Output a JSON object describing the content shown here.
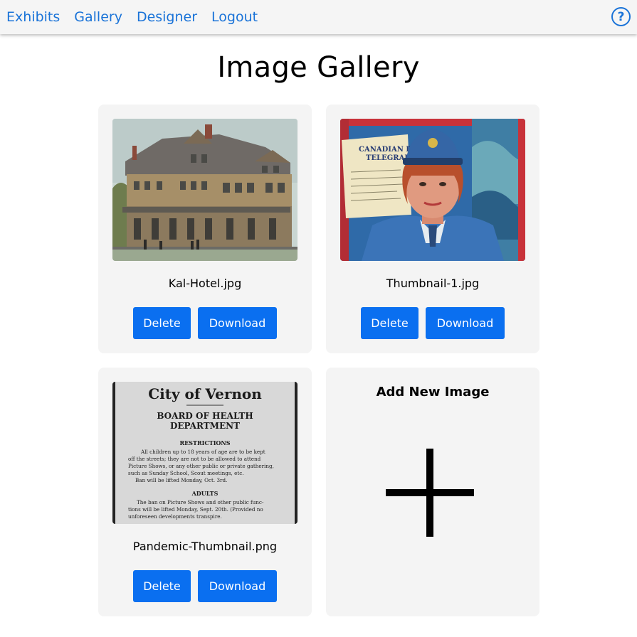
{
  "nav": {
    "links": [
      "Exhibits",
      "Gallery",
      "Designer",
      "Logout"
    ],
    "help_icon": "question-circle-icon",
    "help_glyph": "?"
  },
  "page": {
    "title": "Image Gallery"
  },
  "gallery": {
    "items": [
      {
        "file_name": "Kal-Hotel.jpg",
        "delete_label": "Delete",
        "download_label": "Download"
      },
      {
        "file_name": "Thumbnail-1.jpg",
        "delete_label": "Delete",
        "download_label": "Download",
        "image_text": {
          "telegraph_line1": "CANADIAN PA",
          "telegraph_line2": "TELEGRAP"
        }
      },
      {
        "file_name": "Pandemic-Thumbnail.png",
        "delete_label": "Delete",
        "download_label": "Download",
        "image_text": {
          "heading": "City of Vernon",
          "sub1": "BOARD OF HEALTH",
          "sub2": "DEPARTMENT",
          "restrictions": "RESTRICTIONS",
          "body1": "All children up to 18 years of age are to be kept",
          "body2": "off the streets; they are not to be allowed to attend",
          "body3": "Picture Shows, or any other public or private gathering,",
          "body4": "such as Sunday School, Scout meetings, etc.",
          "body5": "Ban will be lifted Monday, Oct. 3rd.",
          "adults": "ADULTS",
          "body6": "The ban on Picture Shows and other public func-",
          "body7": "tions will be lifted Monday, Sept. 20th. (Provided no",
          "body8": "unforeseen developments transpire."
        }
      }
    ],
    "add_new": {
      "title": "Add New Image",
      "icon": "plus-icon"
    }
  },
  "colors": {
    "accent": "#0a6ff0",
    "nav_link": "#1a73d8",
    "card_bg": "#f4f4f4",
    "navbar_bg": "#f5f5f5"
  }
}
